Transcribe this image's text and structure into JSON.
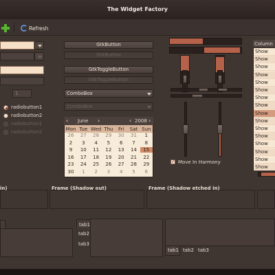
{
  "window": {
    "title": "The Widget Factory"
  },
  "toolbar": {
    "refresh_label": "Refresh"
  },
  "left": {
    "spin_value": "1",
    "radios": [
      {
        "label": "radiobutton1",
        "checked": true,
        "disabled": false
      },
      {
        "label": "radiobutton2",
        "checked": false,
        "disabled": false
      },
      {
        "label": "radiobutton1",
        "checked": true,
        "disabled": true
      },
      {
        "label": "radiobutton2",
        "checked": false,
        "disabled": true
      }
    ]
  },
  "buttons": {
    "gtkbutton": "GtkButton",
    "gtkbutton_disabled": "GtkButton",
    "gtktogglebutton": "GtkToggleButton",
    "gtktogglebutton_disabled": "GtkToggleButton",
    "combobox": "ComboBox",
    "combobox_disabled": "ComboBox"
  },
  "calendar": {
    "month": "June",
    "year": "2008",
    "day_names": [
      "Mon",
      "Tue",
      "Wed",
      "Thu",
      "Fri",
      "Sat",
      "Sun"
    ],
    "weeks": [
      [
        "26",
        "27",
        "28",
        "29",
        "30",
        "31",
        "1"
      ],
      [
        "2",
        "3",
        "4",
        "5",
        "6",
        "7",
        "8"
      ],
      [
        "9",
        "10",
        "11",
        "12",
        "13",
        "14",
        "15"
      ],
      [
        "16",
        "17",
        "18",
        "19",
        "20",
        "21",
        "22"
      ],
      [
        "23",
        "24",
        "25",
        "26",
        "27",
        "28",
        "29"
      ],
      [
        "30",
        "1",
        "2",
        "3",
        "4",
        "5",
        "6"
      ]
    ],
    "selected_day": "15"
  },
  "scales": {
    "move_in_harmony_label": "Move In Harmony"
  },
  "list": {
    "column_label": "Column",
    "rows": [
      "Show",
      "Show",
      "Show",
      "Show",
      "Show",
      "Show",
      "Show",
      "Show",
      "Show",
      "Show",
      "Show",
      "Show",
      "Show",
      "Show",
      "Show",
      "Show"
    ],
    "selected_index": 8
  },
  "frames": {
    "frame_in": "in)",
    "frame_out": "Frame (Shadow out)",
    "frame_etched_in": "Frame (Shadow etched in)"
  },
  "notebooks": {
    "left_tab": "tab1",
    "middle_tabs": [
      "tab1",
      "tab2",
      "tab3"
    ],
    "right_tabs": [
      "tab1",
      "tab2",
      "tab3"
    ]
  },
  "colors": {
    "accent": "#b66149",
    "selection": "#d49a7e",
    "entry_bg": "#f6e0c7"
  }
}
